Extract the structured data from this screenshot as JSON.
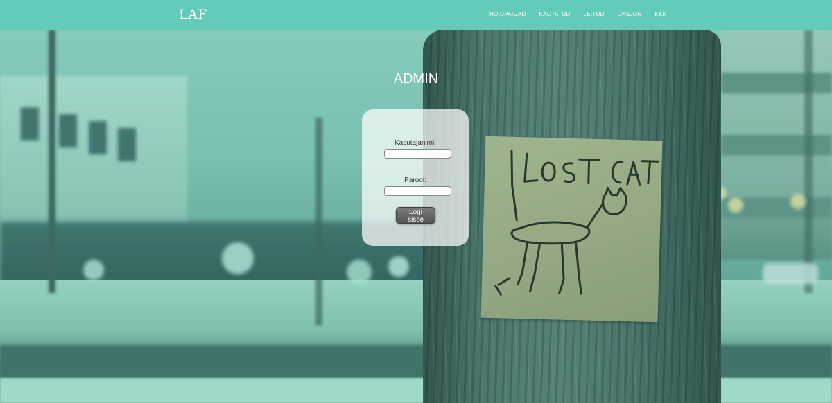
{
  "navbar": {
    "brand": "LAF",
    "links": [
      "HOIUPAIGAD",
      "KAOTATUD",
      "LEITUD",
      "OKSJON",
      "KKK"
    ]
  },
  "page_title": "ADMIN",
  "login_form": {
    "username_label": "Kasutajanimi:",
    "password_label": "Parool:",
    "username_value": "",
    "password_value": "",
    "submit_label": "Logi sisse"
  },
  "colors": {
    "navbar": "#64cbb9",
    "title_text": "#ffffff",
    "button": "#5a5a5a"
  },
  "background_image": "photo of a hand-drawn lost cat poster stapled to a tree trunk, teal tinted"
}
